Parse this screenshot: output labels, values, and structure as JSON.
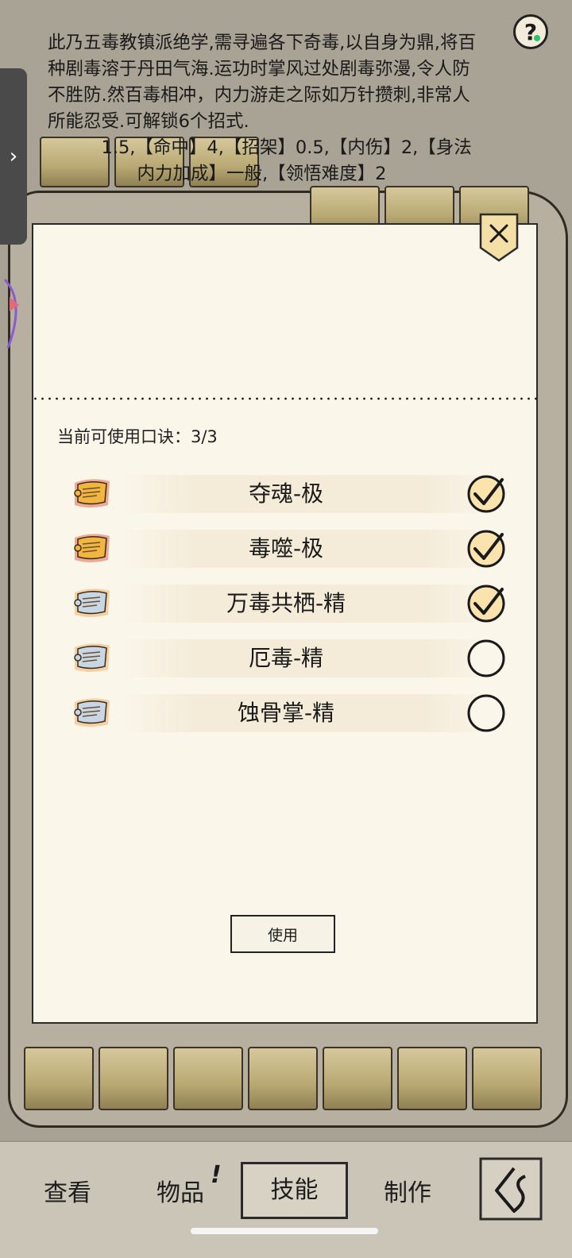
{
  "background": {
    "description_lines": [
      "此乃五毒教镇派绝学,需寻遍各下奇毒,以自身为鼎,将百",
      "种剧毒溶于丹田气海.运功时掌风过处剧毒弥漫,令人防",
      "不胜防.然百毒相冲，内力游走之际如万针攒刺,非常人",
      "所能忍受.可解锁6个招式.",
      "　　　1.5,【命中】4,【招架】0.5,【内伤】2,【身法",
      "　　　　　内力加成】一般,【领悟难度】2"
    ],
    "help_label": "?"
  },
  "dialog": {
    "quota_label": "当前可使用口诀：3/3",
    "use_label": "使用",
    "items": [
      {
        "name": "夺魂-极",
        "tier": "gold",
        "checked": true
      },
      {
        "name": "毒噬-极",
        "tier": "gold",
        "checked": true
      },
      {
        "name": "万毒共栖-精",
        "tier": "blue",
        "checked": true
      },
      {
        "name": "厄毒-精",
        "tier": "blue",
        "checked": false
      },
      {
        "name": "蚀骨掌-精",
        "tier": "blue",
        "checked": false
      }
    ]
  },
  "nav": {
    "view": "查看",
    "items": "物品",
    "items_mark": "!",
    "skills": "技能",
    "craft": "制作"
  },
  "colors": {
    "paper": "#fbf6ea",
    "gold_scroll": "#f2b640",
    "blue_scroll": "#c9d6e4",
    "check_fill": "#fbe3ae"
  }
}
